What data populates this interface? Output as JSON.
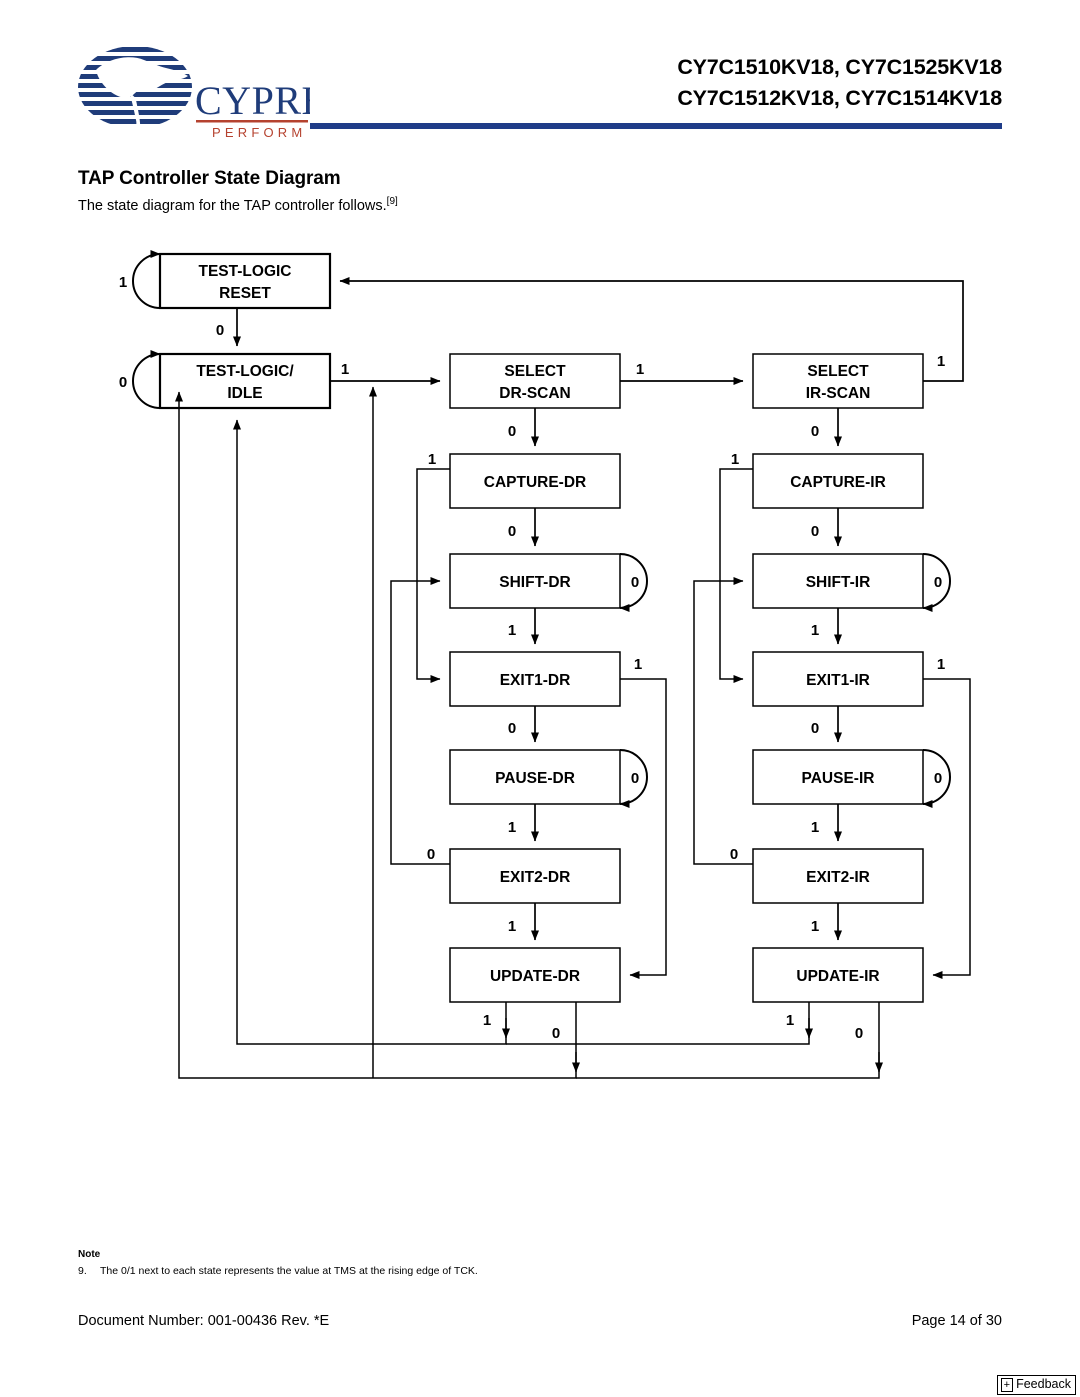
{
  "header": {
    "logo_name": "Cypress",
    "logo_tagline": "PERFORM",
    "part_numbers_line1": "CY7C1510KV18, CY7C1525KV18",
    "part_numbers_line2": "CY7C1512KV18, CY7C1514KV18",
    "rule_color": "#1F3C88"
  },
  "section": {
    "title": "TAP Controller State Diagram",
    "intro": "The state diagram for the TAP controller follows.",
    "intro_footnote": "[9]"
  },
  "diagram": {
    "states": {
      "test_logic_reset_l1": "TEST-LOGIC",
      "test_logic_reset_l2": "RESET",
      "test_logic_idle_l1": "TEST-LOGIC/",
      "test_logic_idle_l2": "IDLE",
      "select_dr_l1": "SELECT",
      "select_dr_l2": "DR-SCAN",
      "select_ir_l1": "SELECT",
      "select_ir_l2": "IR-SCAN",
      "capture_dr": "CAPTURE-DR",
      "shift_dr": "SHIFT-DR",
      "exit1_dr": "EXIT1-DR",
      "pause_dr": "PAUSE-DR",
      "exit2_dr": "EXIT2-DR",
      "update_dr": "UPDATE-DR",
      "capture_ir": "CAPTURE-IR",
      "shift_ir": "SHIFT-IR",
      "exit1_ir": "EXIT1-IR",
      "pause_ir": "PAUSE-IR",
      "exit2_ir": "EXIT2-IR",
      "update_ir": "UPDATE-IR"
    },
    "labels": {
      "tlr_self": "1",
      "tlr_to_idle": "0",
      "idle_self": "0",
      "idle_to_seldr": "1",
      "seldr_to_selir": "1",
      "selir_to_tlr": "1",
      "seldr_to_capdr": "0",
      "selir_to_capir": "0",
      "capdr_to_exit1dr": "1",
      "capdr_to_shiftdr": "0",
      "shiftdr_self": "0",
      "shiftdr_to_exit1dr": "1",
      "exit1dr_to_updatedr": "1",
      "exit1dr_to_pausedr": "0",
      "pausedr_self": "0",
      "pausedr_to_exit2dr": "1",
      "exit2dr_to_shiftdr": "0",
      "exit2dr_to_updatedr": "1",
      "updatedr_to_idle": "1",
      "updatedr_to_seldr": "0",
      "capir_to_exit1ir": "1",
      "capir_to_shiftir": "0",
      "shiftir_self": "0",
      "shiftir_to_exit1ir": "1",
      "exit1ir_to_updateir": "1",
      "exit1ir_to_pauseir": "0",
      "pauseir_self": "0",
      "pauseir_to_exit2ir": "1",
      "exit2ir_to_shiftir": "0",
      "exit2ir_to_updateir": "1",
      "updateir_to_idle": "1",
      "updateir_to_seldr": "0"
    }
  },
  "notes": {
    "heading": "Note",
    "items": [
      {
        "number": "9.",
        "text": "The 0/1 next to each state represents the value at TMS at the rising edge of TCK."
      }
    ]
  },
  "footer": {
    "document_number": "Document Number: 001-00436 Rev. *E",
    "page": "Page 14 of 30",
    "feedback_plus": "+",
    "feedback_label": "Feedback"
  }
}
